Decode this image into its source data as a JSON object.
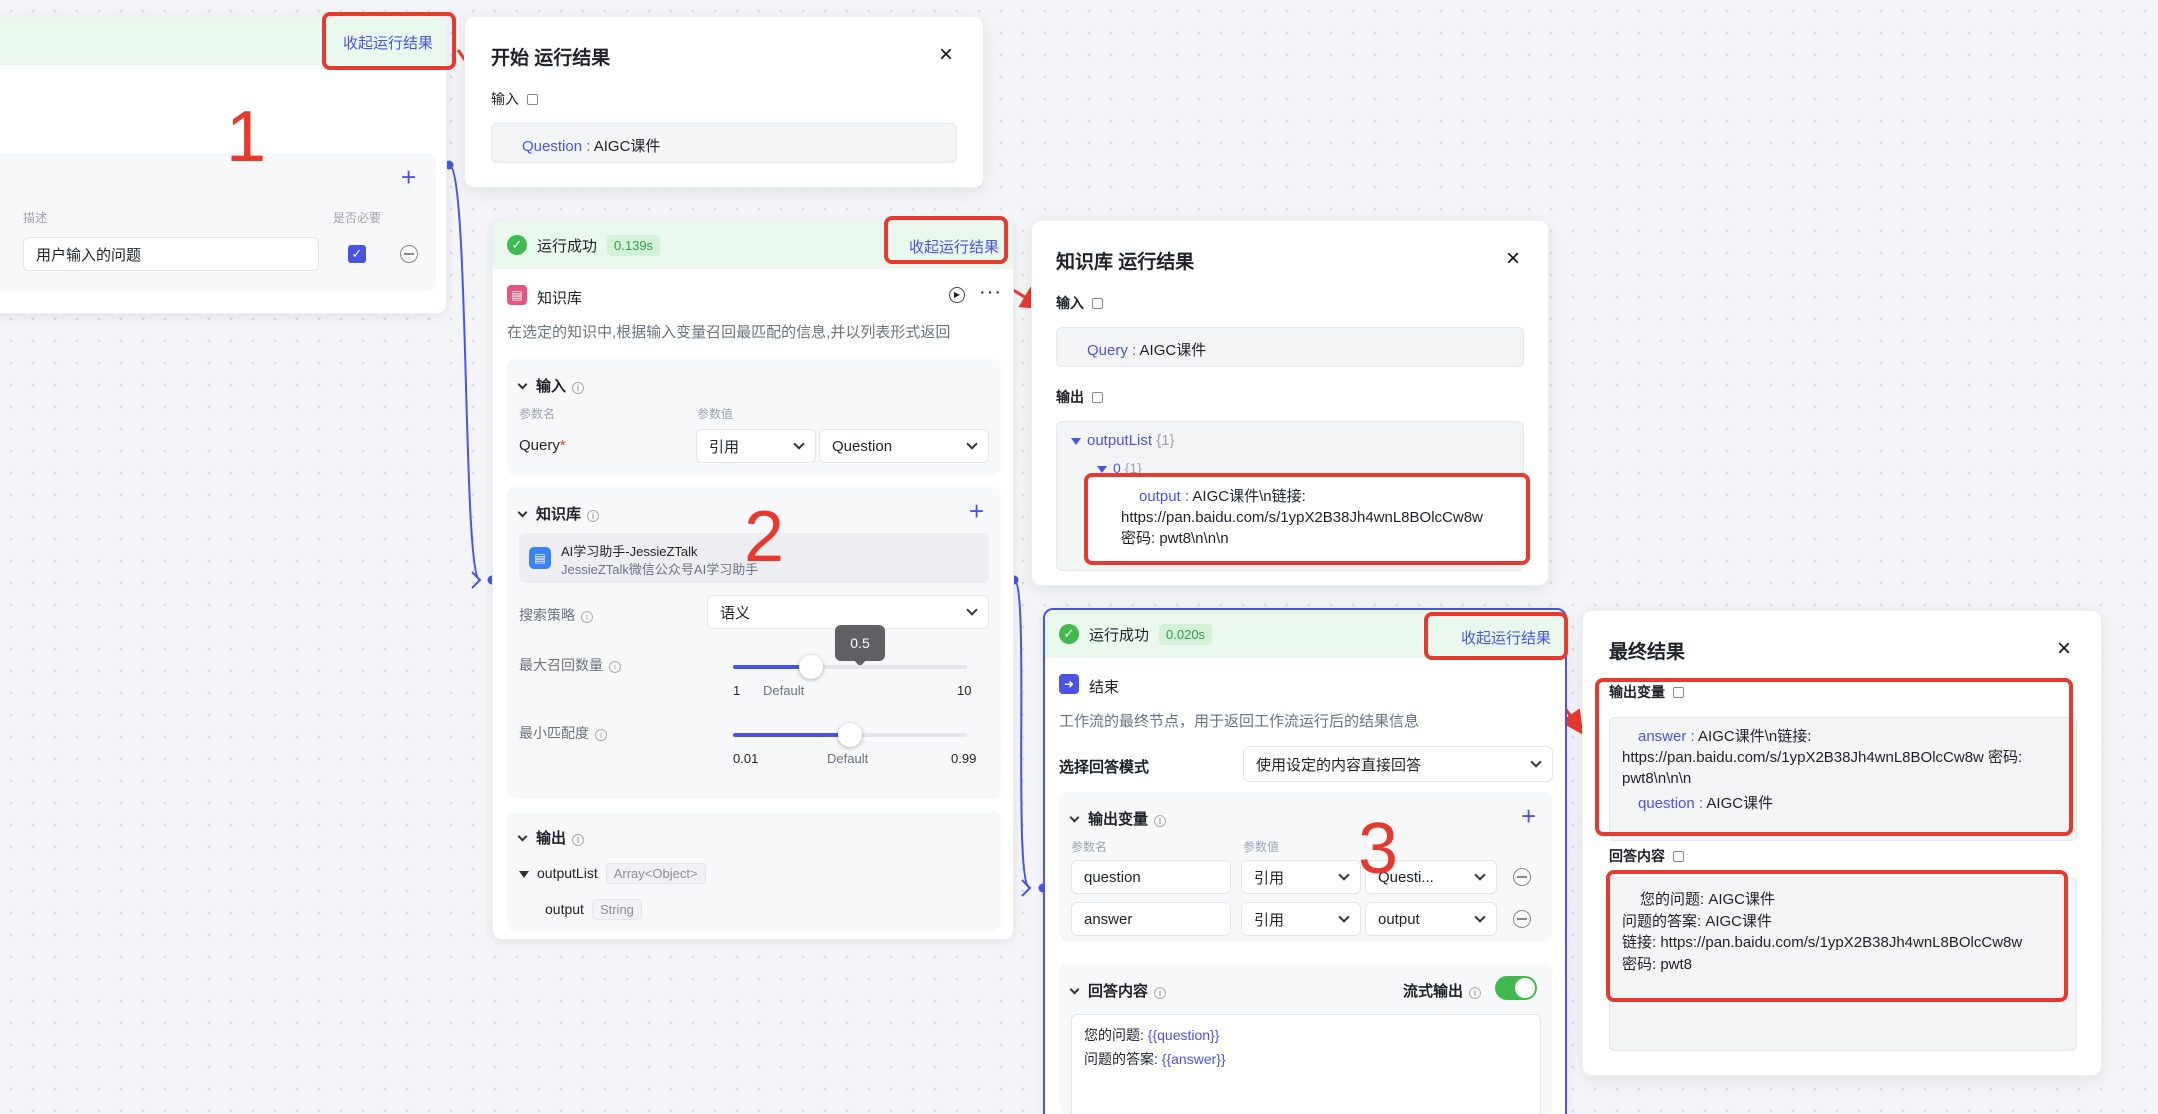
{
  "collapse_label": "收起运行结果",
  "start_node": {
    "desc_header": "描述",
    "required_header": "是否必要",
    "desc_value": "用户输入的问题"
  },
  "start_panel": {
    "title": "开始 运行结果",
    "input_label": "输入",
    "key": "Question",
    "sep": " : ",
    "value": "AIGC课件"
  },
  "kb_node": {
    "status": "运行成功",
    "time": "0.139s",
    "title": "知识库",
    "desc": "在选定的知识中,根据输入变量召回最匹配的信息,并以列表形式返回",
    "input_section": "输入",
    "param_name": "参数名",
    "param_value": "参数值",
    "query_label": "Query",
    "ref_option": "引用",
    "ref_value": "Question",
    "kb_section": "知识库",
    "kb_name": "AI学习助手-JessieZTalk",
    "kb_sub": "JessieZTalk微信公众号AI学习助手",
    "strategy_label": "搜索策略",
    "strategy_value": "语义",
    "max_recall_label": "最大召回数量",
    "tooltip": "0.5",
    "recall_min": "1",
    "recall_default": "Default",
    "recall_max": "10",
    "recall_value": 4,
    "min_match_label": "最小匹配度",
    "match_min": "0.01",
    "match_default": "Default",
    "match_max": "0.99",
    "match_value": 0.5,
    "output_section": "输出",
    "out_list": "outputList",
    "out_list_type": "Array<Object>",
    "out_item": "output",
    "out_item_type": "String"
  },
  "kb_panel": {
    "title": "知识库 运行结果",
    "input_label": "输入",
    "query_key": "Query",
    "sep": " : ",
    "query_value": "AIGC课件",
    "output_label": "输出",
    "list_key": "outputList",
    "list_count": "{1}",
    "index_key": "0",
    "index_count": "{1}",
    "out_key": "output",
    "out_line1": "AIGC课件\\n链接:",
    "out_line2": "https://pan.baidu.com/s/1ypX2B38Jh4wnL8BOlcCw8w",
    "out_line3": "密码: pwt8\\n\\n\\n"
  },
  "end_node": {
    "status": "运行成功",
    "time": "0.020s",
    "title": "结束",
    "desc": "工作流的最终节点，用于返回工作流运行后的结果信息",
    "mode_label": "选择回答模式",
    "mode_value": "使用设定的内容直接回答",
    "vars_section": "输出变量",
    "param_name": "参数名",
    "param_value": "参数值",
    "rows": [
      {
        "name": "question",
        "ref": "引用",
        "value": "Questi..."
      },
      {
        "name": "answer",
        "ref": "引用",
        "value": "output"
      }
    ],
    "answer_section": "回答内容",
    "stream_label": "流式输出",
    "stream_on": true,
    "tpl_line1_text": "您的问题: ",
    "tpl_line1_var": "{{question}}",
    "tpl_line2_text": "问题的答案: ",
    "tpl_line2_var": "{{answer}}"
  },
  "final_panel": {
    "title": "最终结果",
    "vars_label": "输出变量",
    "answer_key": "answer",
    "sep": " : ",
    "answer_line1": "AIGC课件\\n链接:",
    "answer_line2": "https://pan.baidu.com/s/1ypX2B38Jh4wnL8BOlcCw8w  密码:",
    "answer_line3": "pwt8\\n\\n\\n",
    "question_key": "question",
    "question_value": "AIGC课件",
    "content_label": "回答内容",
    "content_lines": [
      "您的问题:  AIGC课件",
      "问题的答案:  AIGC课件",
      "链接: https://pan.baidu.com/s/1ypX2B38Jh4wnL8BOlcCw8w",
      "密码: pwt8"
    ]
  },
  "annotations": {
    "n1": "1",
    "n2": "2",
    "n3": "3"
  },
  "colors": {
    "accent": "#4954e6",
    "success": "#3fb950",
    "annotation": "#e8392e"
  }
}
